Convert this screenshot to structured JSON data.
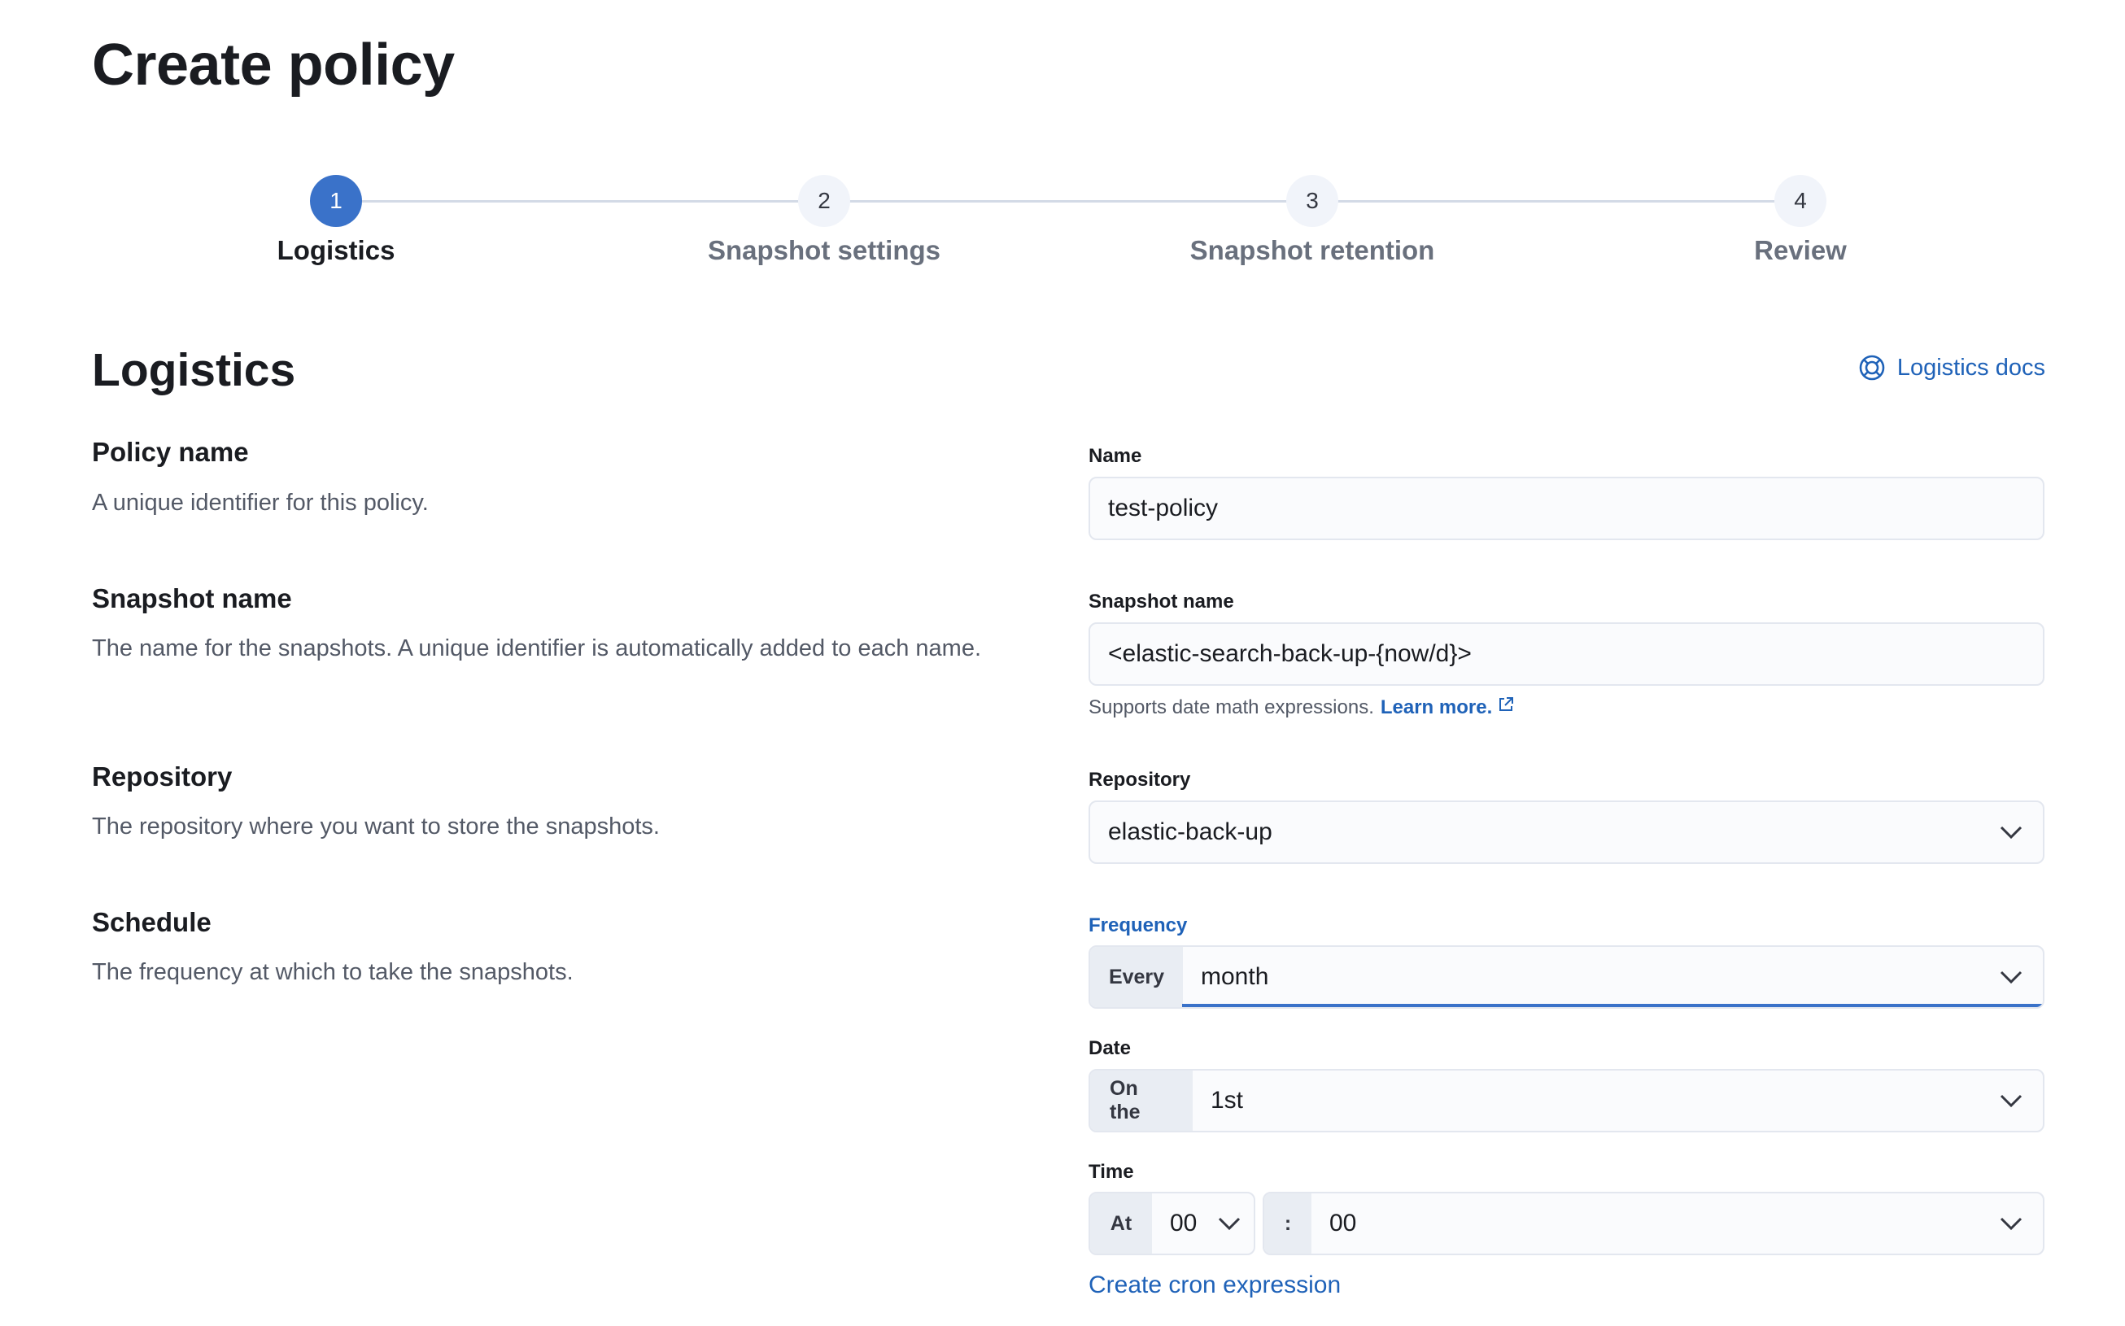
{
  "page": {
    "title": "Create policy"
  },
  "stepper": {
    "steps": [
      {
        "number": "1",
        "label": "Logistics",
        "active": true
      },
      {
        "number": "2",
        "label": "Snapshot settings",
        "active": false
      },
      {
        "number": "3",
        "label": "Snapshot retention",
        "active": false
      },
      {
        "number": "4",
        "label": "Review",
        "active": false
      }
    ]
  },
  "section": {
    "title": "Logistics",
    "docs_link": "Logistics docs",
    "docs_icon": "help-lifebuoy-icon"
  },
  "descriptions": {
    "policy_name": {
      "title": "Policy name",
      "text": "A unique identifier for this policy."
    },
    "snapshot_name": {
      "title": "Snapshot name",
      "text": "The name for the snapshots. A unique identifier is automatically added to each name."
    },
    "repository": {
      "title": "Repository",
      "text": "The repository where you want to store the snapshots."
    },
    "schedule": {
      "title": "Schedule",
      "text": "The frequency at which to take the snapshots."
    }
  },
  "form": {
    "name": {
      "label": "Name",
      "value": "test-policy"
    },
    "snapshot_name": {
      "label": "Snapshot name",
      "value": "<elastic-search-back-up-{now/d}>",
      "help": "Supports date math expressions.",
      "help_link": "Learn more."
    },
    "repository": {
      "label": "Repository",
      "value": "elastic-back-up"
    },
    "frequency": {
      "label": "Frequency",
      "prepend": "Every",
      "value": "month"
    },
    "date": {
      "label": "Date",
      "prepend": "On the",
      "value": "1st"
    },
    "time": {
      "label": "Time",
      "prepend": "At",
      "hour": "00",
      "separator": ":",
      "minute": "00"
    },
    "cron_link": "Create cron expression"
  },
  "colors": {
    "accent": "#3a72c9",
    "link": "#1f62b8",
    "input_bg": "#fafbfd",
    "prepend_bg": "#e9edf3"
  }
}
